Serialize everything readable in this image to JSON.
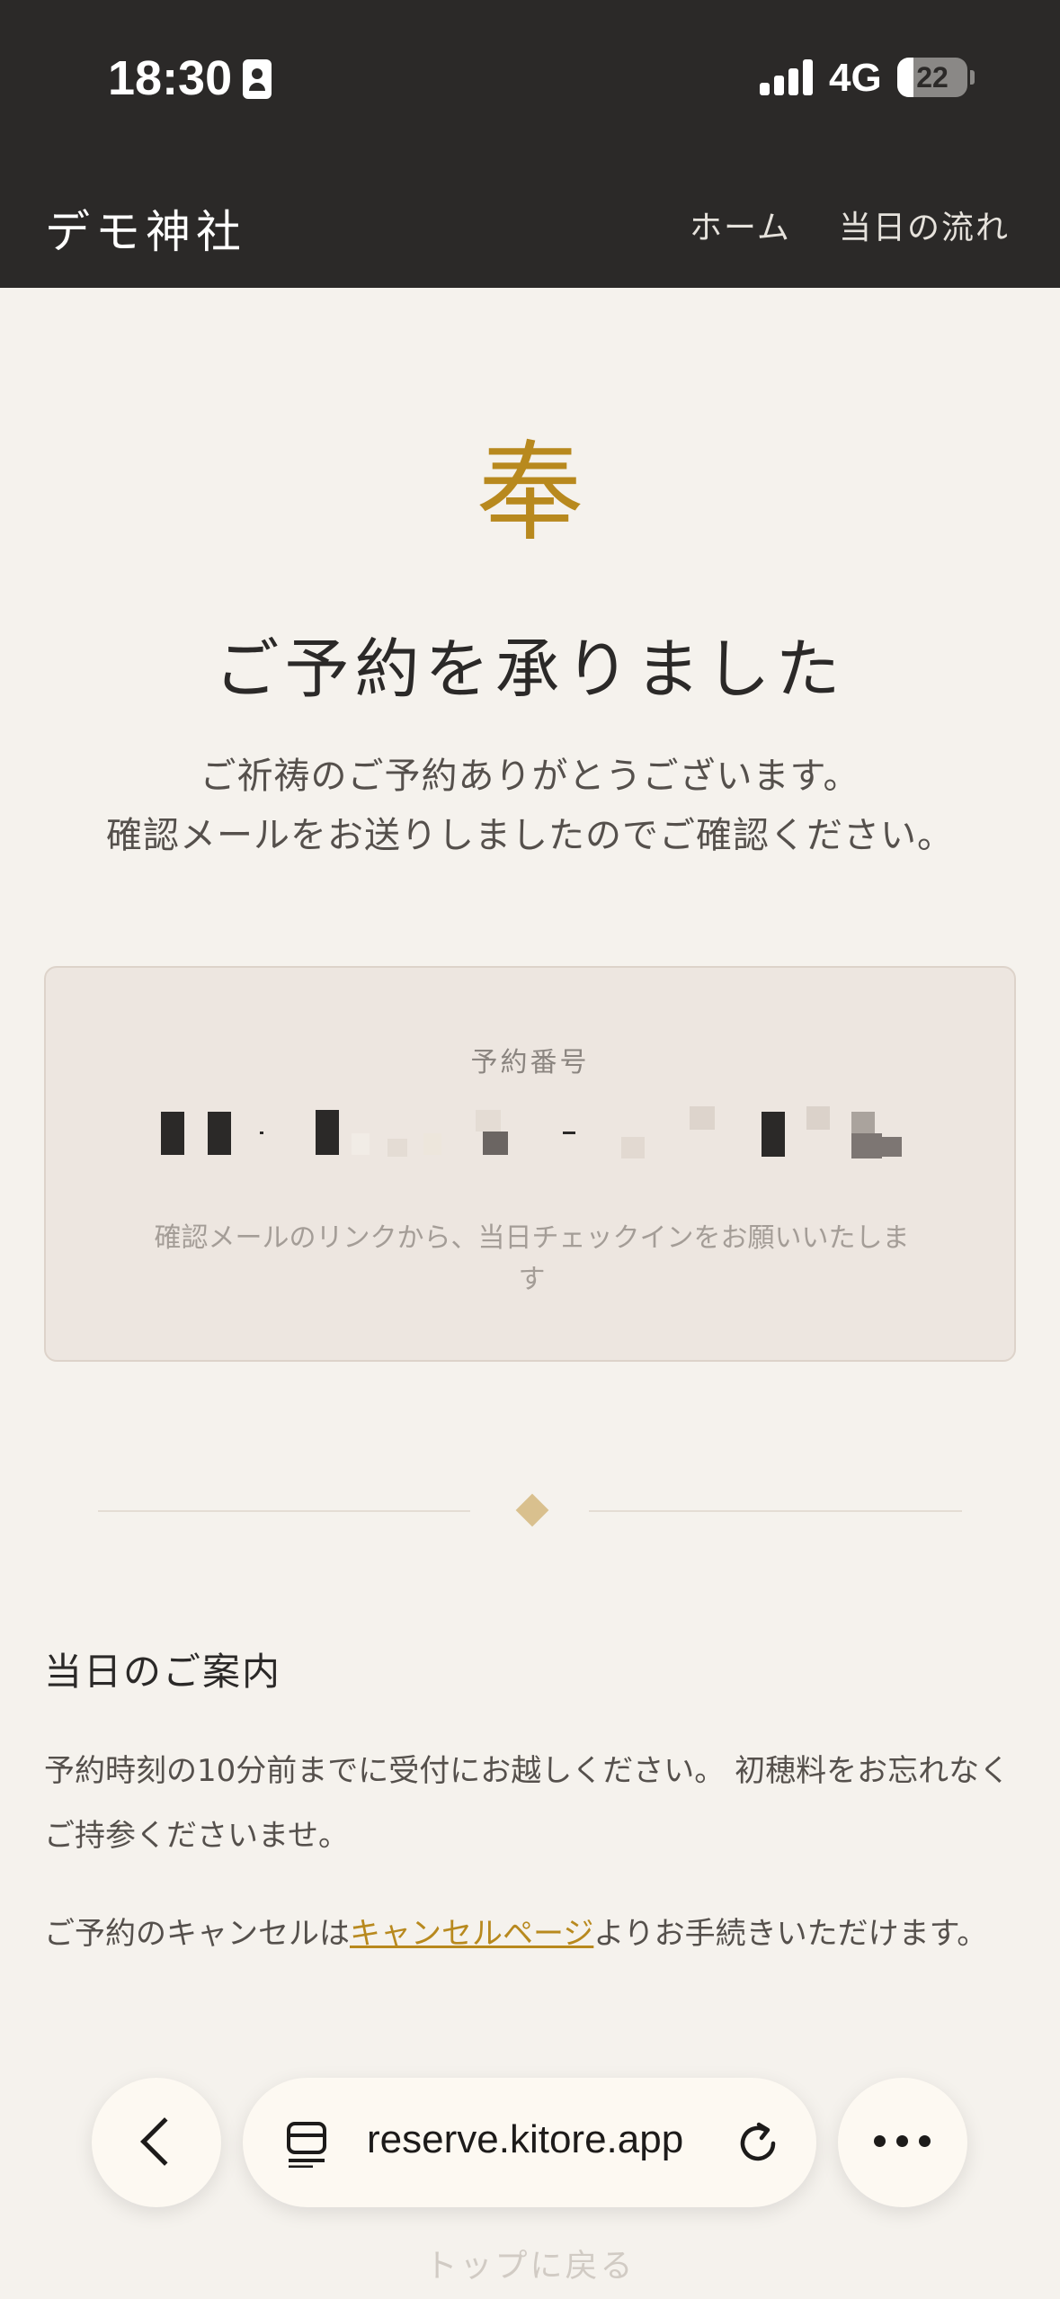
{
  "status_bar": {
    "time": "18:30",
    "network": "4G",
    "battery": "22"
  },
  "header": {
    "site_name": "デモ神社",
    "nav": {
      "home": "ホーム",
      "day_flow": "当日の流れ"
    }
  },
  "confirmation": {
    "mark": "奉",
    "title": "ご予約を承りました",
    "message_line1": "ご祈祷のご予約ありがとうございます。",
    "message_line2": "確認メールをお送りしましたのでご確認ください。"
  },
  "reservation": {
    "label": "予約番号",
    "note": "確認メールのリンクから、当日チェックインをお願いいたします"
  },
  "day_info": {
    "title": "当日のご案内",
    "para1": "予約時刻の10分前までに受付にお越しください。 初穂料をお忘れなくご持参くださいませ。",
    "para2_before": "ご予約のキャンセルは",
    "para2_link": "キャンセルページ",
    "para2_after": "よりお手続きいただけます。"
  },
  "footer": {
    "back_to_top": "トップに戻る"
  },
  "browser": {
    "url": "reserve.kitore.app"
  },
  "colors": {
    "accent_gold": "#b8891e",
    "header_bg": "#2b2928",
    "page_bg": "#f5f2ed",
    "card_bg": "#ede6e0"
  }
}
